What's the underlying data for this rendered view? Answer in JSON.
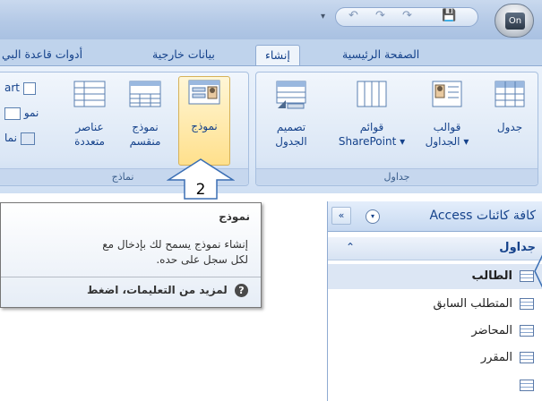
{
  "titlebar": {
    "qat_dropdown": "▾",
    "undo": "↶",
    "redo": "↷",
    "save": "💾",
    "office_logo": "On"
  },
  "tabs": [
    {
      "label": "الصفحة الرئيسية"
    },
    {
      "label": "إنشاء"
    },
    {
      "label": "بيانات خارجية"
    },
    {
      "label": "أدوات قاعدة البي"
    }
  ],
  "ribbon": {
    "tables_group": {
      "label": "جداول",
      "buttons": [
        {
          "line1": "جدول",
          "line2": ""
        },
        {
          "line1": "قوالب",
          "line2": "الجداول ▾"
        },
        {
          "line1": "قوائم",
          "line2": "SharePoint ▾"
        },
        {
          "line1": "تصميم",
          "line2": "الجدول"
        }
      ]
    },
    "forms_group": {
      "label": "نماذج",
      "buttons": [
        {
          "line1": "نموذج",
          "line2": ""
        },
        {
          "line1": "نموذج",
          "line2": "منقسم"
        },
        {
          "line1": "عناصر",
          "line2": "متعددة"
        }
      ],
      "small_items": [
        "art",
        "نمو",
        "نما"
      ]
    },
    "callout_number": "2"
  },
  "tooltip": {
    "title": "نموذج",
    "body_line1": "إنشاء نموذج يسمح لك بإدخال مع",
    "body_line2": "لكل سجل على حده.",
    "help_text": "لمزيد من التعليمات، اضغط",
    "help_icon": "?"
  },
  "nav_pane": {
    "title": "كافة كائنات Access",
    "dropdown_icon": "▾",
    "collapse_icon": "«",
    "section_label": "جداول",
    "section_chevron": "⌃",
    "items": [
      {
        "label": "الطالب"
      },
      {
        "label": "المتطلب السابق"
      },
      {
        "label": "المحاضر"
      },
      {
        "label": "المقرر"
      }
    ]
  },
  "colors": {
    "ribbon_text": "#15428b",
    "highlight": "#ffe08c"
  }
}
